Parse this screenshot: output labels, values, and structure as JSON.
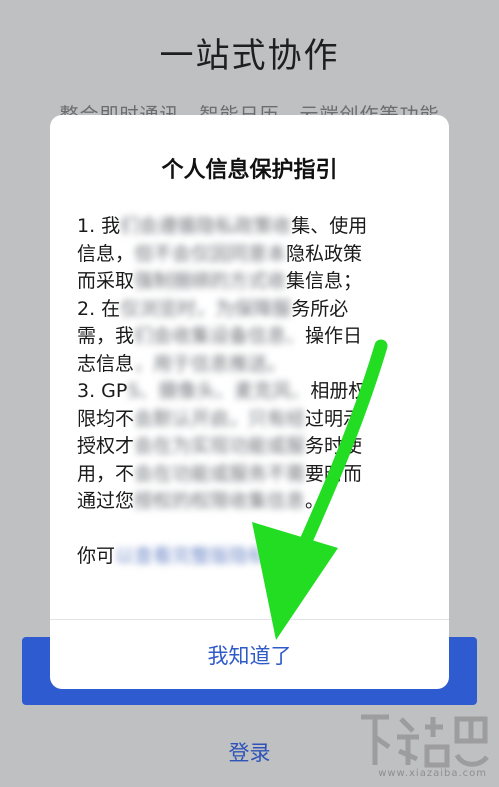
{
  "background_page": {
    "title": "一站式协作",
    "subtitle": "整合即时通讯、智能日历、云端创作等功能",
    "login_label": "登录"
  },
  "dialog": {
    "title": "个人信息保护指引",
    "paragraphs": [
      [
        "1. 我",
        "们会遵循隐私政策收",
        "集、使用"
      ],
      [
        "信息，",
        "但不会仅因同意本",
        "隐私政策"
      ],
      [
        "而采取",
        "强制捆绑的方式收",
        "集信息；"
      ],
      [
        " 2. 在",
        "仅浏览时，为保障服",
        "务所必"
      ],
      [
        "需，我",
        "们会收集设备信息、",
        "操作日"
      ],
      [
        "志信息",
        "，用于信息推送。",
        ""
      ],
      [
        " 3. GP",
        "S、摄像头、麦克风、",
        "相册权"
      ],
      [
        "限均不",
        "会默认开启，只有经",
        "过明示"
      ],
      [
        "授权才",
        "会在为实现功能或服",
        "务时使"
      ],
      [
        "用，不",
        "会在功能或服务不需",
        "要时而"
      ],
      [
        "通过您",
        "授权的权限收集信息",
        "。"
      ]
    ],
    "footer_line": [
      "你可",
      "以查看完整版隐私政",
      "策。"
    ],
    "confirm_button": "我知道了"
  },
  "annotation": {
    "arrow_color": "#22dd22"
  },
  "watermark": {
    "brand": "下载吧",
    "url": "www.xiazaiba.com"
  }
}
